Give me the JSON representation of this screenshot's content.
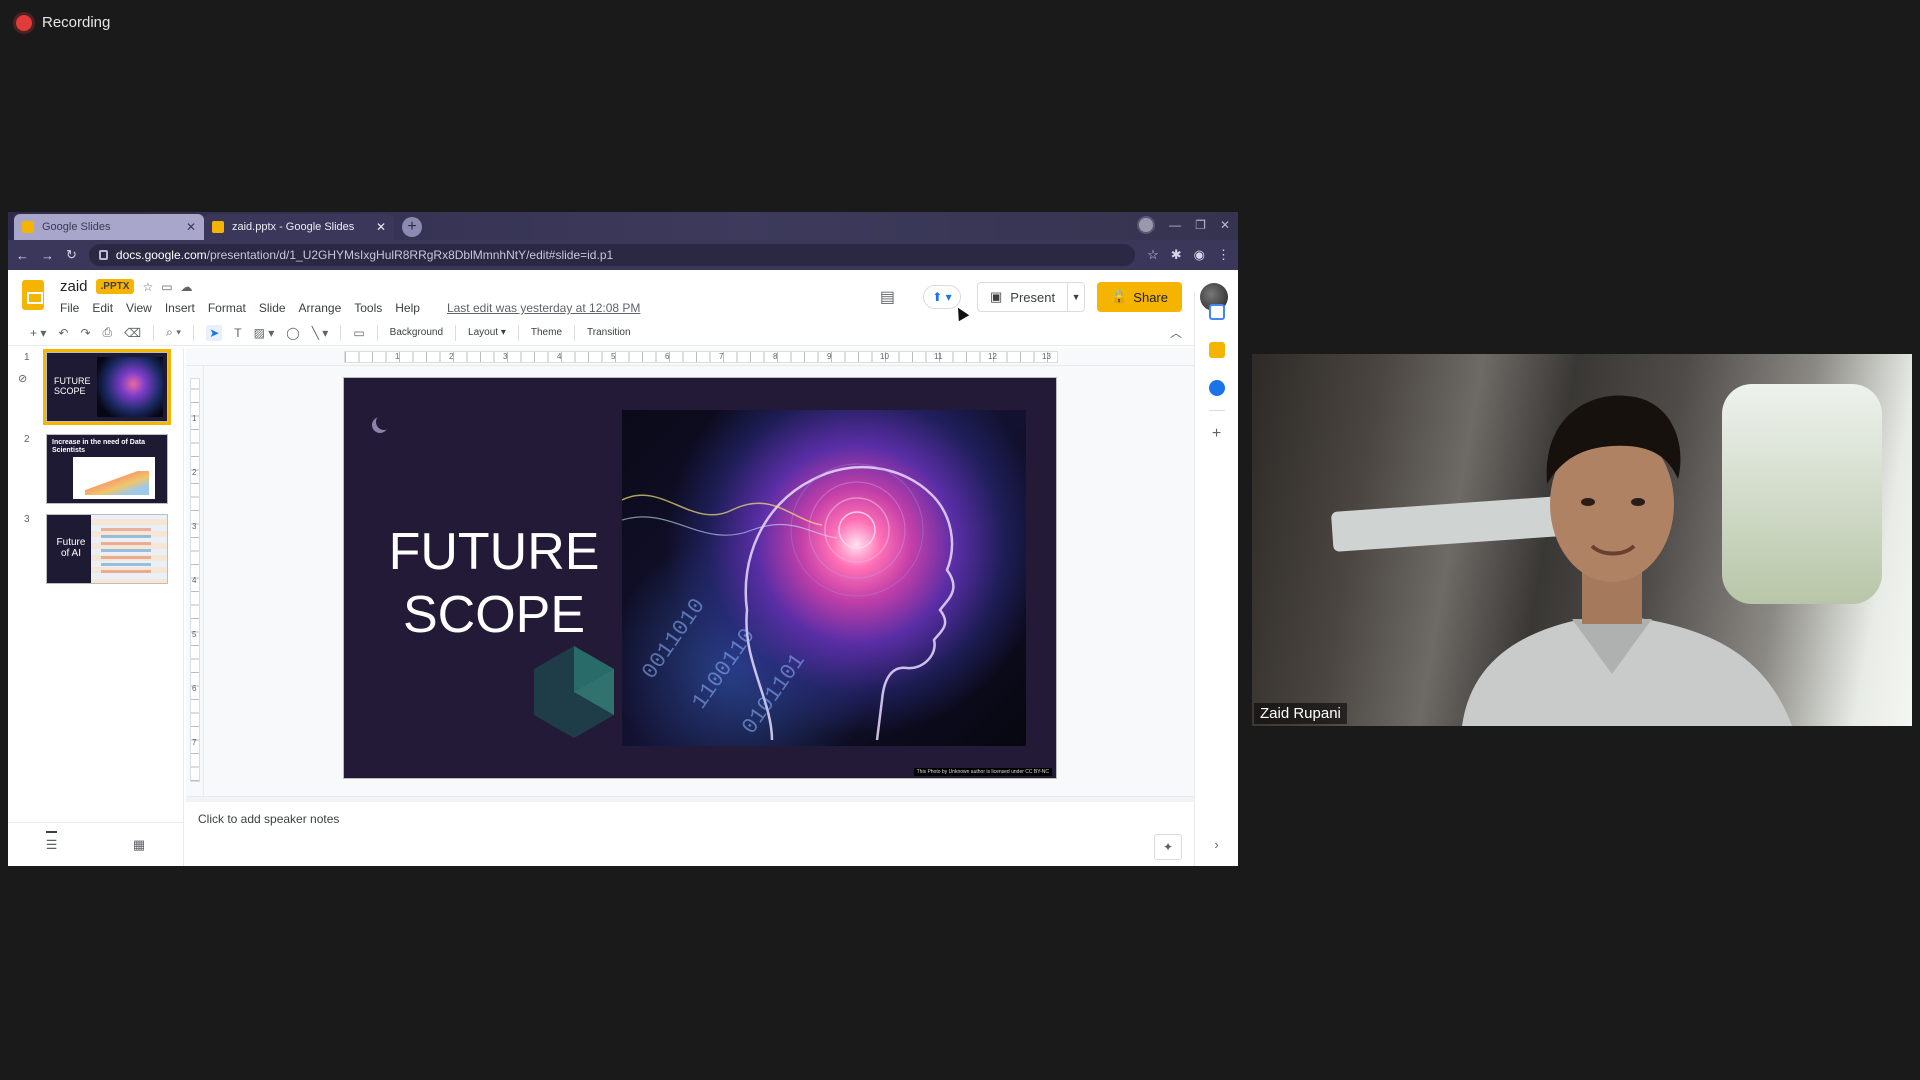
{
  "recorder": {
    "label": "Recording"
  },
  "browser": {
    "tabs": [
      {
        "title": "Google Slides",
        "close": "✕"
      },
      {
        "title": "zaid.pptx - Google Slides",
        "close": "✕"
      }
    ],
    "url_domain": "docs.google.com",
    "url_path": "/presentation/d/1_U2GHYMsIxgHulR8RRgRx8DblMmnhNtY/edit#slide=id.p1"
  },
  "app": {
    "doc_title": "zaid",
    "file_badge": ".PPTX",
    "menu": [
      "File",
      "Edit",
      "View",
      "Insert",
      "Format",
      "Slide",
      "Arrange",
      "Tools",
      "Help"
    ],
    "last_edit": "Last edit was yesterday at 12:08 PM",
    "present_label": "Present",
    "share_label": "Share"
  },
  "toolbar": {
    "background": "Background",
    "layout": "Layout",
    "theme": "Theme",
    "transition": "Transition"
  },
  "ruler": {
    "h": [
      "1",
      "2",
      "3",
      "4",
      "5",
      "6",
      "7",
      "8",
      "9",
      "10",
      "11",
      "12",
      "13"
    ],
    "v": [
      "1",
      "2",
      "3",
      "4",
      "5",
      "6",
      "7"
    ]
  },
  "filmstrip": {
    "slides": [
      {
        "num": "1",
        "text": "FUTURE SCOPE"
      },
      {
        "num": "2",
        "text": "Increase in the need of Data Scientists"
      },
      {
        "num": "3",
        "text": "Future of AI"
      }
    ]
  },
  "slide": {
    "title_line1": "FUTURE",
    "title_line2": "SCOPE",
    "credit": "This Photo by Unknown author is licensed under CC BY-NC"
  },
  "notes": {
    "placeholder": "Click to add speaker notes"
  },
  "webcam": {
    "name": "Zaid Rupani"
  },
  "colors": {
    "accent": "#f4b400",
    "slide_bg": "#231a38"
  }
}
